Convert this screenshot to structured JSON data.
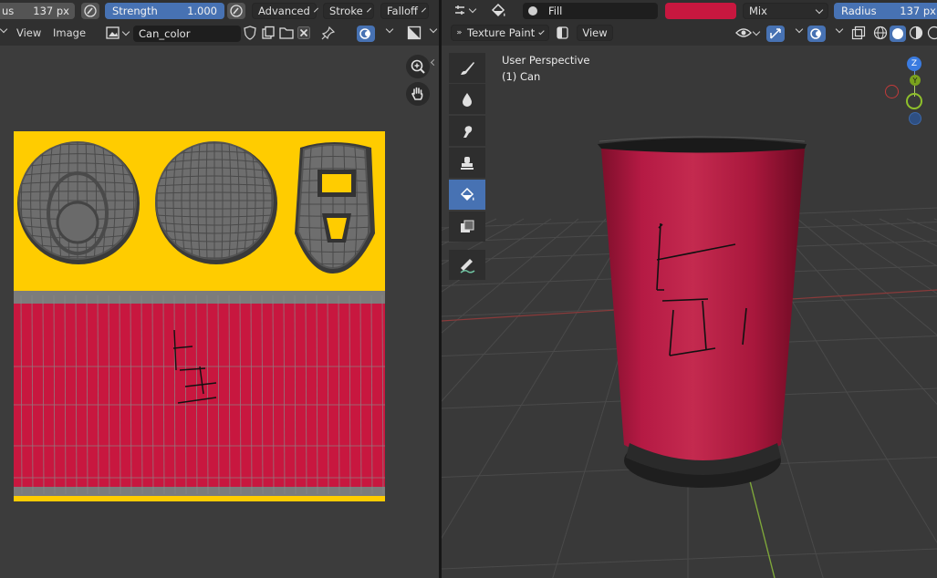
{
  "left_header": {
    "radius_partial": "us",
    "radius_value": "137 px",
    "strength_label": "Strength",
    "strength_value": "1.000",
    "advanced_label": "Advanced",
    "stroke_label": "Stroke",
    "falloff_label": "Falloff"
  },
  "left_menu": {
    "view_label": "View",
    "image_label": "Image",
    "image_name": "Can_color"
  },
  "right_header": {
    "brush_name": "Fill",
    "brush_color": "#c8173f",
    "blend_mode": "Mix",
    "radius_label": "Radius",
    "radius_value": "137 px"
  },
  "right_menu": {
    "mode_label": "Texture Paint",
    "view_label": "View"
  },
  "viewport": {
    "perspective_label": "User Perspective",
    "object_label": "(1) Can",
    "gizmo_z": "Z",
    "gizmo_y": "Y"
  },
  "colors": {
    "uv_yellow": "#ffcc00",
    "can_red": "#c8173f",
    "accent_blue": "#4772b3"
  },
  "icons": {
    "tools": [
      "draw-icon",
      "soften-icon",
      "smear-icon",
      "clone-icon",
      "fill-icon",
      "mask-icon",
      "annotate-icon"
    ]
  }
}
